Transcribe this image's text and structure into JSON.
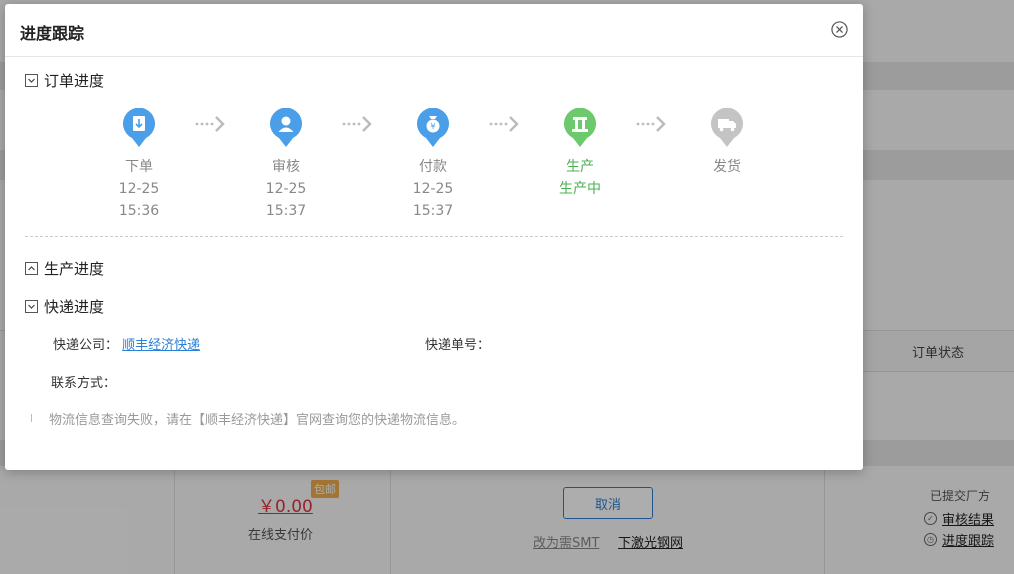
{
  "background": {
    "column_header": "订单状态",
    "price": "￥0.00",
    "badge": "包邮",
    "price_note": "在线支付价",
    "cancel_button": "取消",
    "link_smt": "改为需SMT",
    "link_order": "下激光钢网",
    "status_text": "已提交厂方",
    "action_review": "审核结果",
    "action_track": "进度跟踪"
  },
  "modal": {
    "title": "进度跟踪",
    "order_section": {
      "title": "订单进度",
      "expanded": true
    },
    "steps": [
      {
        "label": "下单",
        "date": "12-25",
        "time": "15:36",
        "icon": "download-doc-icon",
        "state": "done",
        "color": "#4a9fe8"
      },
      {
        "label": "审核",
        "date": "12-25",
        "time": "15:37",
        "icon": "person-icon",
        "state": "done",
        "color": "#4a9fe8"
      },
      {
        "label": "付款",
        "date": "12-25",
        "time": "15:37",
        "icon": "money-bag-icon",
        "state": "done",
        "color": "#4a9fe8"
      },
      {
        "label": "生产",
        "date": "生产中",
        "time": "",
        "icon": "production-icon",
        "state": "active",
        "color": "#6cc96c"
      },
      {
        "label": "发货",
        "date": "",
        "time": "",
        "icon": "truck-icon",
        "state": "pending",
        "color": "#c4c4c4"
      }
    ],
    "production_section": {
      "title": "生产进度",
      "expanded": false
    },
    "express_section": {
      "title": "快递进度",
      "expanded": true,
      "company_label": "快递公司：",
      "company_value": "顺丰经济快递",
      "tracking_label": "快递单号：",
      "tracking_value": "",
      "contact_label": "联系方式：",
      "contact_value": "",
      "message": "物流信息查询失败，请在【顺丰经济快递】官网查询您的快递物流信息。"
    }
  }
}
